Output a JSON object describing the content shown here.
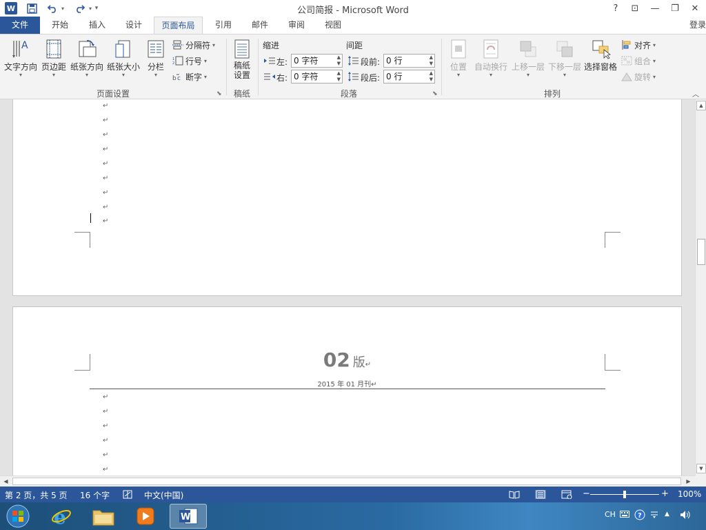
{
  "window": {
    "title": "公司简报 - Microsoft Word",
    "word_logo": "W",
    "help": "?",
    "controls": {
      "ribbon_display": "⊡",
      "minimize": "—",
      "restore": "❐",
      "close": "✕"
    }
  },
  "quick_access": {
    "customize": "▾"
  },
  "tabs": [
    {
      "label": "文件"
    },
    {
      "label": "开始"
    },
    {
      "label": "插入"
    },
    {
      "label": "设计"
    },
    {
      "label": "页面布局"
    },
    {
      "label": "引用"
    },
    {
      "label": "邮件"
    },
    {
      "label": "审阅"
    },
    {
      "label": "视图"
    }
  ],
  "login": "登录",
  "ribbon": {
    "page_setup": {
      "label": "页面设置",
      "text_direction": "文字方向",
      "margins": "页边距",
      "orientation": "纸张方向",
      "size": "纸张大小",
      "columns": "分栏",
      "breaks": "分隔符",
      "line_numbers": "行号",
      "hyphenation": "断字"
    },
    "manuscript": {
      "label": "稿纸",
      "settings_line1": "稿纸",
      "settings_line2": "设置"
    },
    "paragraph": {
      "label": "段落",
      "indent_title": "缩进",
      "spacing_title": "间距",
      "left_label": "左:",
      "right_label": "右:",
      "before_label": "段前:",
      "after_label": "段后:",
      "indent_left": "0 字符",
      "indent_right": "0 字符",
      "spacing_before": "0 行",
      "spacing_after": "0 行"
    },
    "arrange": {
      "label": "排列",
      "position": "位置",
      "wrap_text": "自动换行",
      "bring_forward": "上移一层",
      "send_backward": "下移一层",
      "selection_pane": "选择窗格",
      "align": "对齐",
      "group": "组合",
      "rotate": "旋转"
    }
  },
  "document": {
    "paragraph_mark": "↵",
    "page2_header_number": "02",
    "page2_header_suffix": "版",
    "page2_date": "2015 年 01 月刊"
  },
  "status": {
    "page": "第 2 页，共 5 页",
    "words": "16 个字",
    "language": "中文(中国)",
    "zoom": "100%",
    "zoom_minus": "−",
    "zoom_plus": "+",
    "zoom_level": 0.5
  },
  "taskbar": {
    "tray_lang": "CH"
  },
  "colors": {
    "accent": "#2b579a",
    "ribbon_bg": "#f3f3f3",
    "doc_bg": "#e3e3e3"
  }
}
